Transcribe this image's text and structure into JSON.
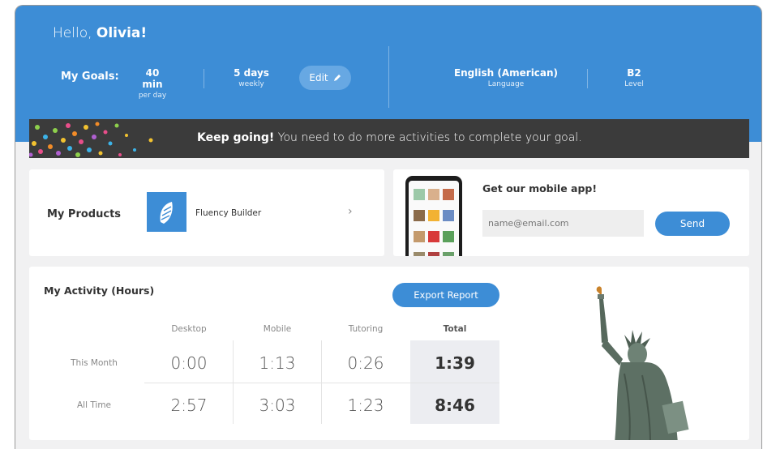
{
  "header": {
    "greeting": "Hello,",
    "user_name": "Olivia!",
    "goals_label": "My Goals:",
    "goal_time_value": "40 min",
    "goal_time_sub": "per day",
    "goal_days_value": "5 days",
    "goal_days_sub": "weekly",
    "edit_label": "Edit",
    "language_value": "English (American)",
    "language_sub": "Language",
    "level_value": "B2",
    "level_sub": "Level"
  },
  "banner": {
    "bold": "Keep going!",
    "text": " You need to do more activities to complete your goal."
  },
  "products": {
    "title": "My Products",
    "item_name": "Fluency Builder"
  },
  "mobile_app": {
    "title": "Get our mobile app!",
    "email_placeholder": "name@email.com",
    "send_label": "Send"
  },
  "activity": {
    "title": "My Activity (Hours)",
    "export_label": "Export Report",
    "columns": [
      "Desktop",
      "Mobile",
      "Tutoring",
      "Total"
    ],
    "rows": [
      {
        "label": "This Month",
        "values": [
          "0:00",
          "1:13",
          "0:26",
          "1:39"
        ]
      },
      {
        "label": "All Time",
        "values": [
          "2:57",
          "3:03",
          "1:23",
          "8:46"
        ]
      }
    ]
  },
  "colors": {
    "primary": "#3d8dd6",
    "banner": "#3b3b3b",
    "background": "#f1f1f2"
  }
}
